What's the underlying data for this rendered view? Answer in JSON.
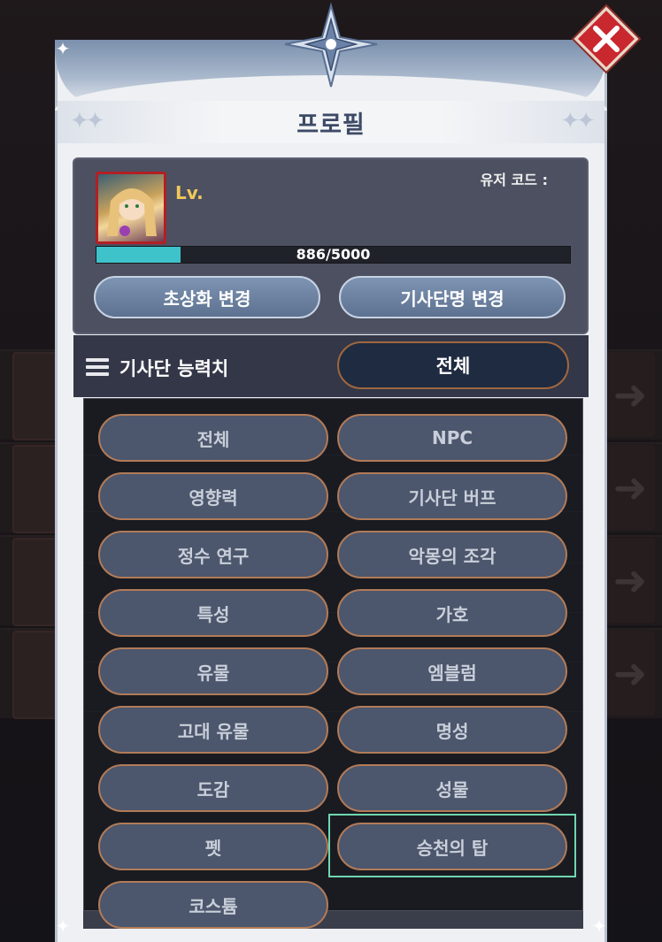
{
  "dialog": {
    "title": "프로필",
    "close_icon": "x-icon"
  },
  "profile": {
    "level_label": "Lv.",
    "user_code_label": "유저 코드 :",
    "xp": {
      "current": 886,
      "max": 5000,
      "text": "886/5000",
      "fraction": 0.177
    },
    "change_portrait_label": "초상화 변경",
    "change_name_label": "기사단명 변경"
  },
  "stats": {
    "header_label": "기사단 능력치",
    "filter_selected": "전체"
  },
  "dropdown": {
    "options": [
      "전체",
      "NPC",
      "영향력",
      "기사단 버프",
      "정수 연구",
      "악몽의 조각",
      "특성",
      "가호",
      "유물",
      "엠블럼",
      "고대 유물",
      "명성",
      "도감",
      "성물",
      "펫",
      "승천의 탑",
      "코스튬"
    ],
    "highlighted": "승천의 탑"
  },
  "colors": {
    "accent_cyan": "#3ec3cb",
    "close_red": "#c8282e",
    "option_border": "#b27b58",
    "highlight_green": "#6fd7b0"
  }
}
